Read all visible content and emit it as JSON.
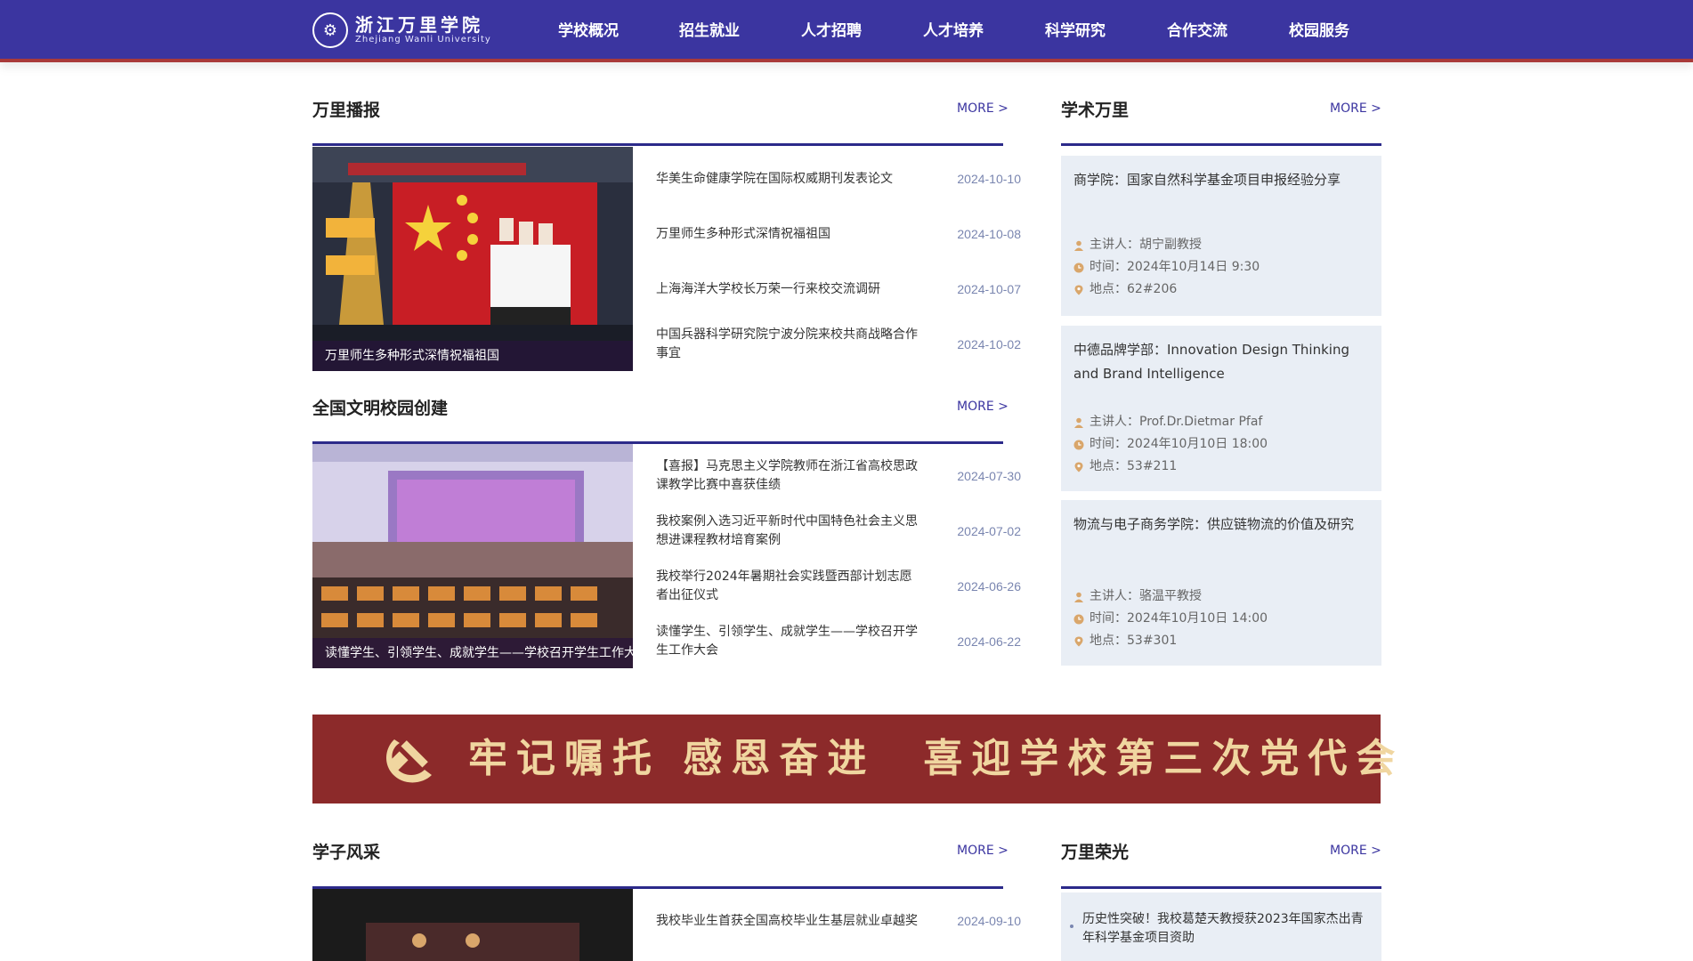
{
  "header": {
    "logo_cn": "浙江万里学院",
    "logo_en": "Zhejiang Wanli University",
    "nav": [
      "学校概况",
      "招生就业",
      "人才招聘",
      "人才培养",
      "科学研究",
      "合作交流",
      "校园服务"
    ]
  },
  "wanli_news": {
    "title": "万里播报",
    "more": "MORE >",
    "feature_caption": "万里师生多种形式深情祝福祖国",
    "items": [
      {
        "title": "华美生命健康学院在国际权威期刊发表论文",
        "date": "2024-10-10"
      },
      {
        "title": "万里师生多种形式深情祝福祖国",
        "date": "2024-10-08"
      },
      {
        "title": "上海海洋大学校长万荣一行来校交流调研",
        "date": "2024-10-07"
      },
      {
        "title": "中国兵器科学研究院宁波分院来校共商战略合作事宜",
        "date": "2024-10-02"
      }
    ]
  },
  "civilized_campus": {
    "title": "全国文明校园创建",
    "more": "MORE >",
    "feature_caption": "读懂学生、引领学生、成就学生——学校召开学生工作大会",
    "items": [
      {
        "title": "【喜报】马克思主义学院教师在浙江省高校思政课教学比赛中喜获佳绩",
        "date": "2024-07-30"
      },
      {
        "title": "我校案例入选习近平新时代中国特色社会主义思想进课程教材培育案例",
        "date": "2024-07-02"
      },
      {
        "title": "我校举行2024年暑期社会实践暨西部计划志愿者出征仪式",
        "date": "2024-06-26"
      },
      {
        "title": "读懂学生、引领学生、成就学生——学校召开学生工作大会",
        "date": "2024-06-22"
      }
    ]
  },
  "academic": {
    "title": "学术万里",
    "more": "MORE >",
    "cards": [
      {
        "title": "商学院：国家自然科学基金项目申报经验分享",
        "speaker": "主讲人：胡宁副教授",
        "time": "时间：2024年10月14日 9:30",
        "place": "地点：62#206"
      },
      {
        "title": "中德品牌学部：Innovation Design Thinking and Brand Intelligence",
        "speaker": "主讲人：Prof.Dr.Dietmar Pfaf",
        "time": "时间：2024年10月10日 18:00",
        "place": "地点：53#211"
      },
      {
        "title": "物流与电子商务学院：供应链物流的价值及研究",
        "speaker": "主讲人：骆温平教授",
        "time": "时间：2024年10月10日 14:00",
        "place": "地点：53#301"
      }
    ]
  },
  "banner": {
    "text": "牢记嘱托 感恩奋进　喜迎学校第三次党代会"
  },
  "student_style": {
    "title": "学子风采",
    "more": "MORE >",
    "items": [
      {
        "title": "我校毕业生首获全国高校毕业生基层就业卓越奖",
        "date": "2024-09-10"
      }
    ]
  },
  "honor": {
    "title": "万里荣光",
    "more": "MORE >",
    "items": [
      {
        "title": "历史性突破！我校葛楚天教授获2023年国家杰出青年科学基金项目资助"
      }
    ]
  },
  "colors": {
    "header": "#3b35a0",
    "header_border": "#a93a3a",
    "accent_line": "#2c2a8a",
    "date": "#7a86b0",
    "card_bg": "#e9eef5",
    "banner_bg": "#8c2a2a",
    "banner_text": "#f0d6a0",
    "meta_icon": "#d9a66b"
  }
}
